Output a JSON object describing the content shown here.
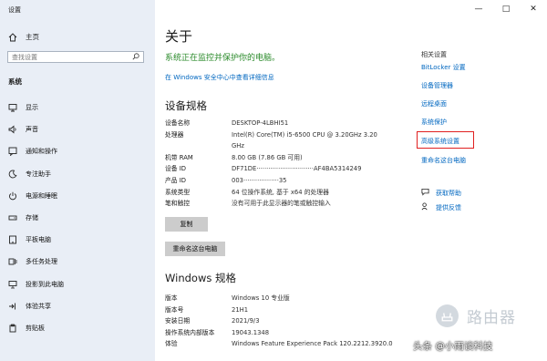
{
  "window": {
    "title": "设置"
  },
  "sidebar": {
    "home_label": "主页",
    "search_placeholder": "查找设置",
    "section_label": "系统",
    "items": [
      {
        "label": "显示",
        "icon": "display-icon"
      },
      {
        "label": "声音",
        "icon": "speaker-icon"
      },
      {
        "label": "通知和操作",
        "icon": "notification-icon"
      },
      {
        "label": "专注助手",
        "icon": "moon-icon"
      },
      {
        "label": "电源和睡眠",
        "icon": "power-icon"
      },
      {
        "label": "存储",
        "icon": "storage-icon"
      },
      {
        "label": "平板电脑",
        "icon": "tablet-icon"
      },
      {
        "label": "多任务处理",
        "icon": "multitask-icon"
      },
      {
        "label": "投影到此电脑",
        "icon": "projection-icon"
      },
      {
        "label": "体验共享",
        "icon": "share-icon"
      },
      {
        "label": "剪贴板",
        "icon": "clipboard-icon"
      }
    ]
  },
  "main": {
    "title": "关于",
    "protect_text": "系统正在监控并保护你的电脑。",
    "security_link": "在 Windows 安全中心中查看详细信息",
    "device_specs": {
      "heading": "设备规格",
      "rows": [
        {
          "key": "设备名称",
          "value": "DESKTOP-4LBHI51"
        },
        {
          "key": "处理器",
          "value": "Intel(R) Core(TM) i5-6500 CPU @ 3.20GHz   3.20 GHz"
        },
        {
          "key": "机带 RAM",
          "value": "8.00 GB (7.86 GB 可用)"
        },
        {
          "key": "设备 ID",
          "value": "DF71DE·····························AF4BA5314249"
        },
        {
          "key": "产品 ID",
          "value": "003··················35"
        },
        {
          "key": "系统类型",
          "value": "64 位操作系统, 基于 x64 的处理器"
        },
        {
          "key": "笔和触控",
          "value": "没有可用于此显示器的笔或触控输入"
        }
      ],
      "copy_button": "复制",
      "rename_button": "重命名这台电脑"
    },
    "windows_specs": {
      "heading": "Windows 规格",
      "rows": [
        {
          "key": "版本",
          "value": "Windows 10 专业版"
        },
        {
          "key": "版本号",
          "value": "21H1"
        },
        {
          "key": "安装日期",
          "value": "2021/9/3"
        },
        {
          "key": "操作系统内部版本",
          "value": "19043.1348"
        },
        {
          "key": "体验",
          "value": "Windows Feature Experience Pack 120.2212.3920.0"
        }
      ]
    }
  },
  "related": {
    "heading": "相关设置",
    "links": [
      "BitLocker 设置",
      "设备管理器",
      "远程桌面",
      "系统保护",
      "高级系统设置",
      "重命名这台电脑"
    ],
    "help_links": [
      {
        "label": "获取帮助",
        "icon": "help-chat-icon"
      },
      {
        "label": "提供反馈",
        "icon": "feedback-icon"
      }
    ]
  },
  "watermark": {
    "text": "路由器",
    "credit": "头条 @小雨谈科技"
  },
  "colors": {
    "sidebar_bg": "#e9eef6",
    "link": "#0067c0",
    "protect_green": "#2a8a2a",
    "highlight_red": "#e02020"
  }
}
